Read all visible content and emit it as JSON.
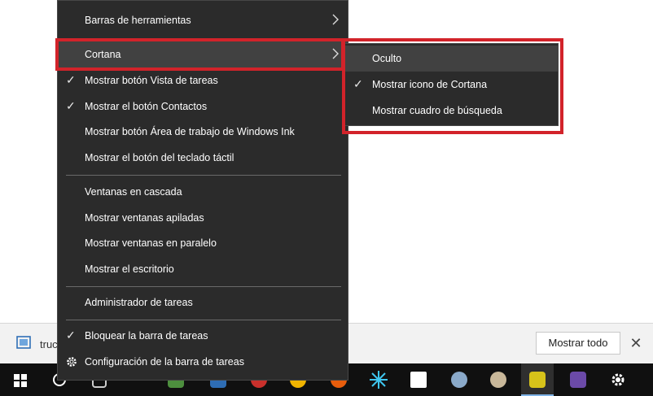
{
  "menu": {
    "items": [
      {
        "label": "Barras de herramientas",
        "checked": false,
        "submenu": true
      },
      {
        "label": "Cortana",
        "checked": false,
        "submenu": true
      },
      {
        "label": "Mostrar botón Vista de tareas",
        "checked": true
      },
      {
        "label": "Mostrar el botón Contactos",
        "checked": true
      },
      {
        "label": "Mostrar botón Área de trabajo de Windows Ink",
        "checked": false
      },
      {
        "label": "Mostrar el botón del teclado táctil",
        "checked": false
      },
      {
        "label": "Ventanas en cascada",
        "checked": false
      },
      {
        "label": "Mostrar ventanas apiladas",
        "checked": false
      },
      {
        "label": "Mostrar ventanas en paralelo",
        "checked": false
      },
      {
        "label": "Mostrar el escritorio",
        "checked": false
      },
      {
        "label": "Administrador de tareas",
        "checked": false
      },
      {
        "label": "Bloquear la barra de tareas",
        "checked": true
      },
      {
        "label": "Configuración de la barra de tareas",
        "icon": "gear-icon"
      }
    ]
  },
  "submenu": {
    "items": [
      {
        "label": "Oculto",
        "checked": false
      },
      {
        "label": "Mostrar icono de Cortana",
        "checked": true
      },
      {
        "label": "Mostrar cuadro de búsqueda",
        "checked": false
      }
    ]
  },
  "download_bar": {
    "filename": "truc",
    "show_all": "Mostrar todo"
  },
  "colors": {
    "menu_bg": "#2b2b2b",
    "highlight": "#d2232a",
    "taskbar": "#101010"
  }
}
